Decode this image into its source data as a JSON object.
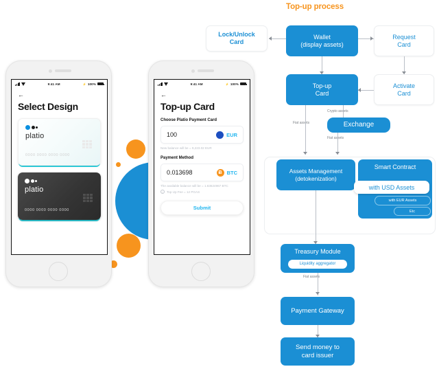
{
  "flow": {
    "title": "Top-up process",
    "nodes": {
      "lock_unlock": "Lock/Unlock\nCard",
      "wallet": "Wallet\n(display assets)",
      "request_card": "Request\nCard",
      "topup_card": "Top-up\nCard",
      "activate_card": "Activate\nCard",
      "exchange": "Exchange",
      "assets_management": "Assets Management\n(detokenization)",
      "smart_contract": "Smart Contract",
      "smart_contract_usd": "with USD Assets",
      "smart_contract_eur": "with EUR Assets",
      "smart_contract_etc": "Etc",
      "treasury_module": "Treasury Module",
      "liquidity_aggregator": "Liquidity aggregator",
      "payment_gateway": "Payment Gateway",
      "send_money": "Send money to\ncard issuer"
    },
    "edge_labels": {
      "crypto_assets": "Crypto assets",
      "fiat_assets_left": "Fiat assets",
      "fiat_assets_exchange": "Fiat assets",
      "fiat_assets_treasury": "Fiat assets"
    },
    "colors": {
      "accent_blue": "#1b8fd4",
      "title_orange": "#f7941e",
      "edge_gray": "#b9bec6"
    }
  },
  "phone_left": {
    "status": {
      "time": "9:41 AM",
      "battery": "100%"
    },
    "back": "←",
    "title": "Select Design",
    "cards": [
      {
        "brand": "platio",
        "number": "0000 0000 0000 0000",
        "theme": "light"
      },
      {
        "brand": "platio",
        "number": "0000 0000 0000 0000",
        "theme": "dark"
      }
    ]
  },
  "phone_right": {
    "status": {
      "time": "9:41 AM",
      "battery": "100%"
    },
    "back": "←",
    "title": "Top-up Card",
    "choose_label": "Choose Platio Payment Card",
    "amount_value": "100",
    "amount_currency": "EUR",
    "amount_hint": "New balance will be = 9,223.02 EUR",
    "payment_method_label": "Payment Method",
    "crypto_value": "0.013698",
    "crypto_currency": "BTC",
    "crypto_symbol": "Ƀ",
    "crypto_hint": "The available balance will be = 1.63624967 BTC",
    "fee_text": "Top Up Fee = 12 PGAS",
    "submit_label": "Submit"
  }
}
